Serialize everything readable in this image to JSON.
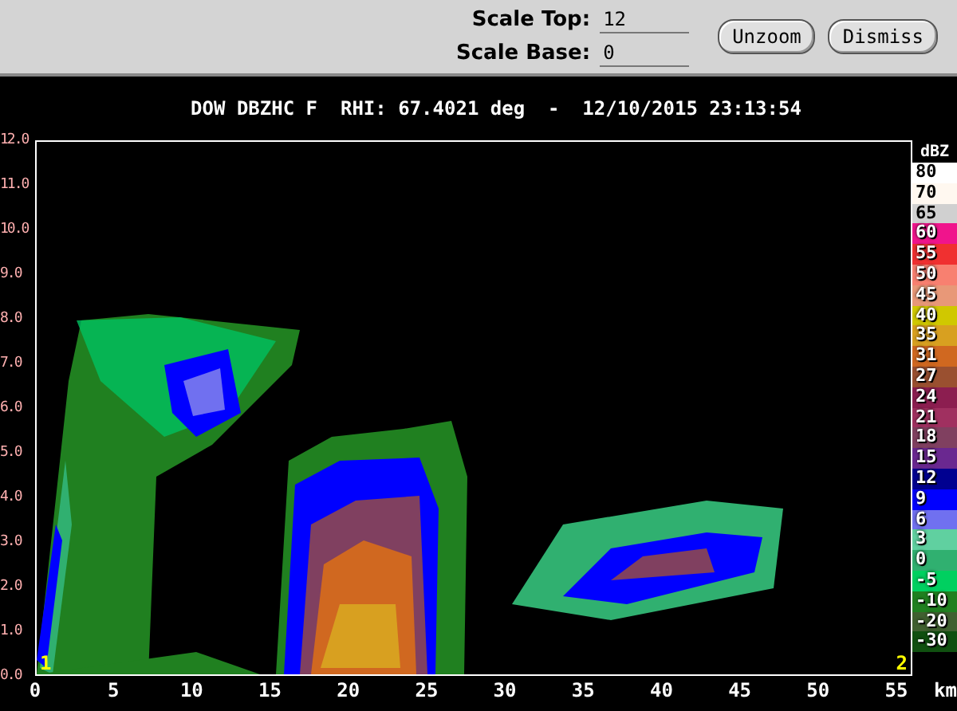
{
  "controls": {
    "fields": [
      {
        "label": "Scale Top:",
        "value": "12"
      },
      {
        "label": "Scale Base:",
        "value": "0"
      }
    ],
    "buttons": [
      "Unzoom",
      "Dismiss"
    ]
  },
  "plot": {
    "title": "DOW DBZHC F  RHI: 67.4021 deg  -  12/10/2015 23:13:54",
    "y_ticks": [
      "12.0",
      "11.0",
      "10.0",
      "9.0",
      "8.0",
      "7.0",
      "6.0",
      "5.0",
      "4.0",
      "3.0",
      "2.0",
      "1.0",
      "0.0"
    ],
    "x_ticks": [
      "0",
      "5",
      "10",
      "15",
      "20",
      "25",
      "30",
      "35",
      "40",
      "45",
      "50",
      "55"
    ],
    "x_unit": "km",
    "markers": [
      "1",
      "2"
    ]
  },
  "color_scale": {
    "unit": "dBZ",
    "entries": [
      {
        "label": "80",
        "color": "#ffffff"
      },
      {
        "label": "70",
        "color": "#fff8f0"
      },
      {
        "label": "65",
        "color": "#d0d0d0"
      },
      {
        "label": "60",
        "color": "#f0148c"
      },
      {
        "label": "55",
        "color": "#f03030"
      },
      {
        "label": "50",
        "color": "#f88070"
      },
      {
        "label": "45",
        "color": "#e89878"
      },
      {
        "label": "40",
        "color": "#d0c800"
      },
      {
        "label": "35",
        "color": "#d8a020"
      },
      {
        "label": "31",
        "color": "#d06820"
      },
      {
        "label": "27",
        "color": "#9a5030"
      },
      {
        "label": "24",
        "color": "#8c1e50"
      },
      {
        "label": "21",
        "color": "#a03060"
      },
      {
        "label": "18",
        "color": "#804060"
      },
      {
        "label": "15",
        "color": "#6a2890"
      },
      {
        "label": "12",
        "color": "#000090"
      },
      {
        "label": "9",
        "color": "#0000ff"
      },
      {
        "label": "6",
        "color": "#7070f0"
      },
      {
        "label": "3",
        "color": "#60d0a0"
      },
      {
        "label": "0",
        "color": "#30b070"
      },
      {
        "label": "-5",
        "color": "#00d060"
      },
      {
        "label": "-10",
        "color": "#208020"
      },
      {
        "label": "-20",
        "color": "#406030"
      },
      {
        "label": "-30",
        "color": "#105010"
      }
    ]
  }
}
